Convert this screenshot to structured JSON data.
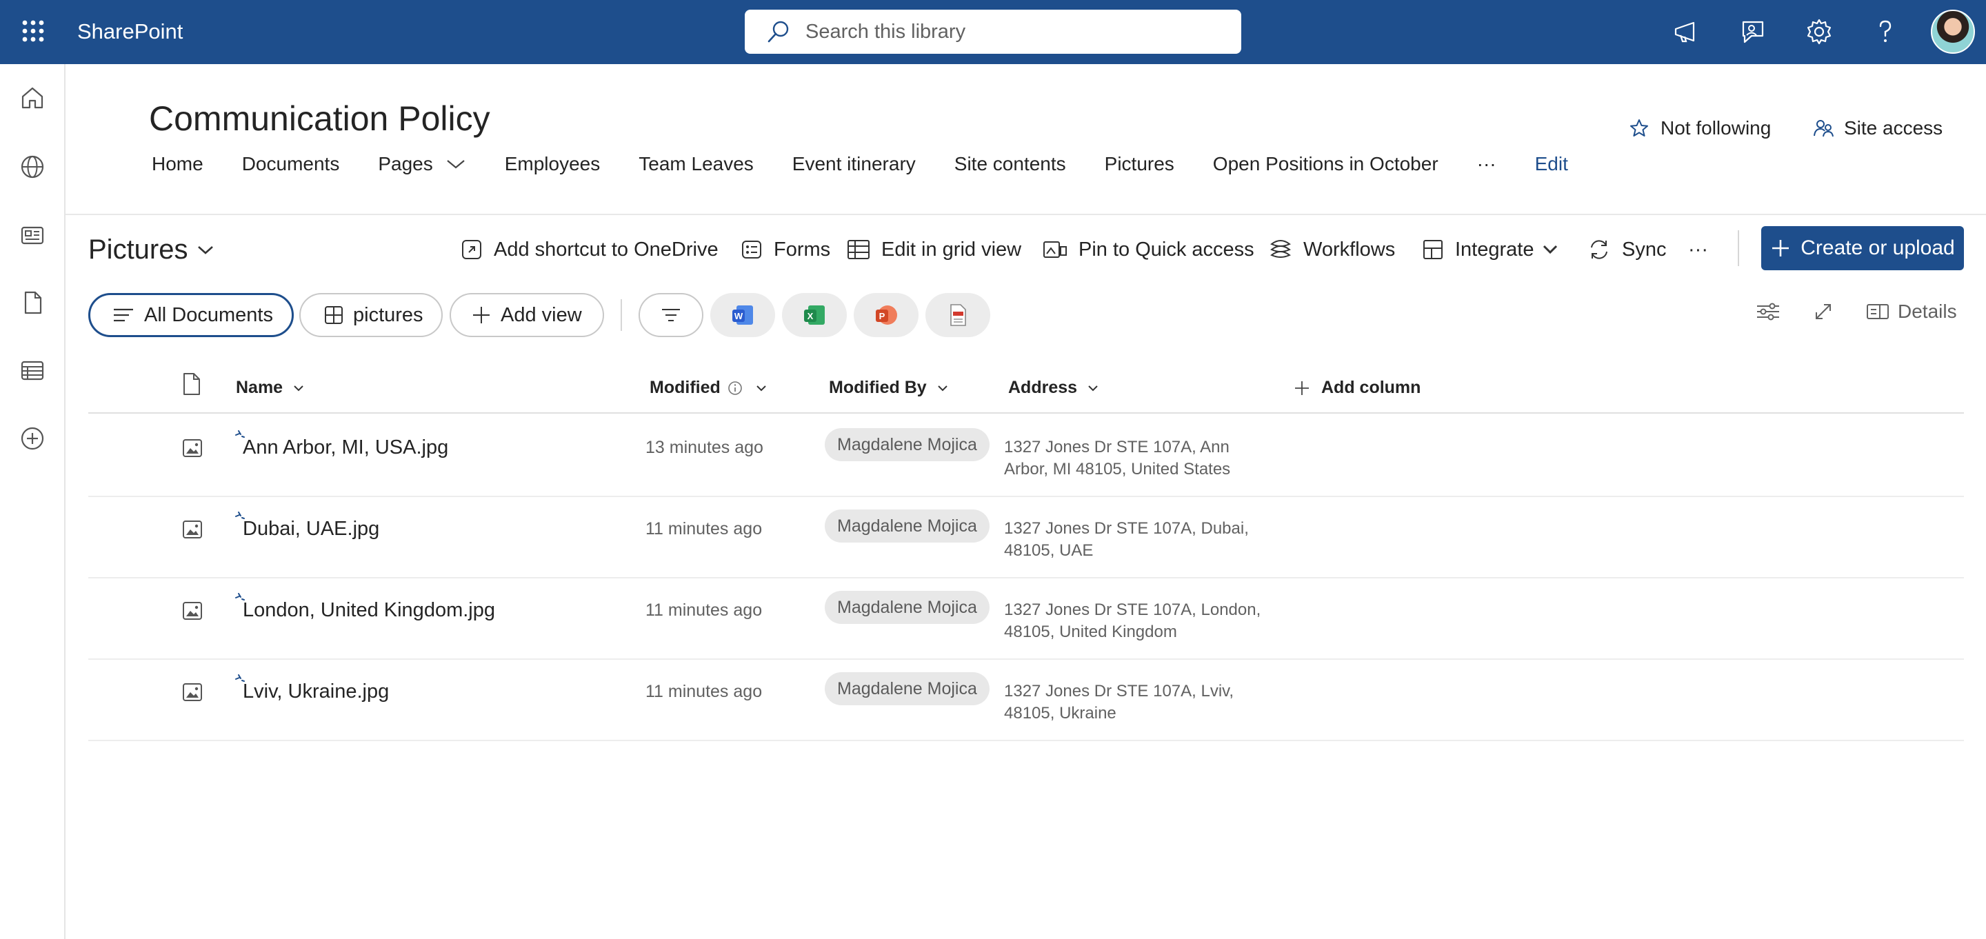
{
  "app": {
    "name": "SharePoint"
  },
  "search": {
    "placeholder": "Search this library"
  },
  "site": {
    "title": "Communication Policy",
    "nav": [
      "Home",
      "Documents",
      "Pages",
      "Employees",
      "Team Leaves",
      "Event itinerary",
      "Site contents",
      "Pictures",
      "Open Positions in October",
      "···",
      "Edit"
    ],
    "follow_label": "Not following",
    "site_access_label": "Site access"
  },
  "library": {
    "title": "Pictures",
    "commands": {
      "add_shortcut": "Add shortcut to OneDrive",
      "forms": "Forms",
      "edit_grid": "Edit in grid view",
      "pin": "Pin to Quick access",
      "workflows": "Workflows",
      "integrate": "Integrate",
      "sync": "Sync",
      "more": "···",
      "create": "Create or upload"
    },
    "views": {
      "all_documents": "All Documents",
      "pictures": "pictures",
      "add_view": "Add view"
    },
    "details_label": "Details"
  },
  "table": {
    "columns": {
      "name": "Name",
      "modified": "Modified",
      "modified_by": "Modified By",
      "address": "Address",
      "add_column": "Add column"
    },
    "rows": [
      {
        "name": "Ann Arbor, MI, USA.jpg",
        "modified": "13 minutes ago",
        "modified_by": "Magdalene Mojica",
        "address_line1": "1327 Jones Dr STE 107A, Ann",
        "address_line2": "Arbor, MI 48105, United States"
      },
      {
        "name": "Dubai, UAE.jpg",
        "modified": "11 minutes ago",
        "modified_by": "Magdalene Mojica",
        "address_line1": "1327 Jones Dr STE 107A, Dubai,",
        "address_line2": "48105, UAE"
      },
      {
        "name": "London, United Kingdom.jpg",
        "modified": "11 minutes ago",
        "modified_by": "Magdalene Mojica",
        "address_line1": "1327 Jones Dr STE 107A, London,",
        "address_line2": "48105, United Kingdom"
      },
      {
        "name": "Lviv, Ukraine.jpg",
        "modified": "11 minutes ago",
        "modified_by": "Magdalene Mojica",
        "address_line1": "1327 Jones Dr STE 107A, Lviv,",
        "address_line2": "48105, Ukraine"
      }
    ]
  },
  "colors": {
    "suitebar": "#1e4e8c",
    "accent": "#1e4e8c",
    "word": "#2b5ccf",
    "excel": "#1f8a4c",
    "powerpoint": "#d24726"
  }
}
